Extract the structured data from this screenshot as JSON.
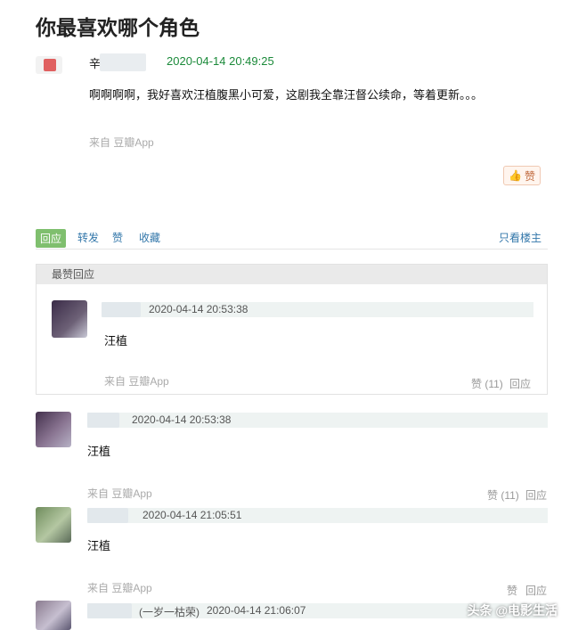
{
  "title": "你最喜欢哪个角色",
  "post": {
    "author_partial": "辛",
    "timestamp": "2020-04-14 20:49:25",
    "content": "啊啊啊啊，我好喜欢汪植腹黑小可爱，这剧我全靠汪督公续命，等着更新。。。",
    "source": "来自 豆瓣App",
    "like_label": "赞"
  },
  "actions": {
    "reply": "回应",
    "forward": "转发",
    "like": "赞",
    "collect": "收藏",
    "only_op": "只看楼主"
  },
  "best": {
    "header": "最赞回应",
    "timestamp": "2020-04-14 20:53:38",
    "content": "汪植",
    "source": "来自 豆瓣App",
    "likes": "赞 (11)",
    "reply": "回应"
  },
  "replies": [
    {
      "timestamp": "2020-04-14 20:53:38",
      "content": "汪植",
      "source": "来自 豆瓣App",
      "likes": "赞 (11)",
      "reply": "回应"
    },
    {
      "timestamp": "2020-04-14 21:05:51",
      "content": "汪植",
      "source": "来自 豆瓣App",
      "likes": "赞",
      "reply": "回应"
    },
    {
      "name_suffix": "(一岁一枯荣)",
      "timestamp": "2020-04-14 21:06:07"
    }
  ],
  "watermark": "头条 @电影生活"
}
